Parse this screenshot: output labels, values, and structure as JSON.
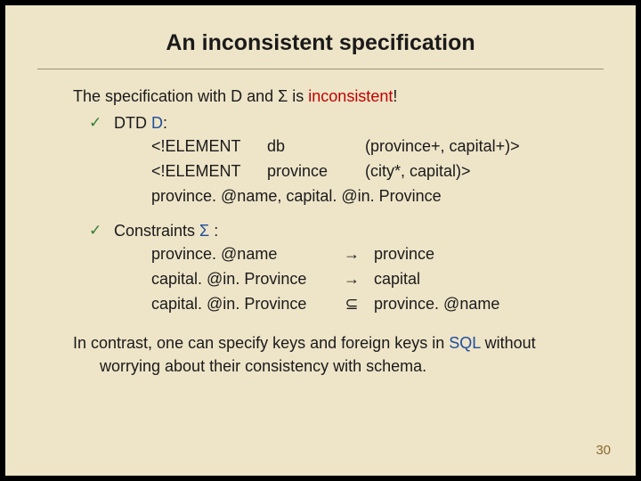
{
  "title": "An inconsistent specification",
  "intro": {
    "pre": "The specification with D and ",
    "sigma": "Σ",
    "mid": " is ",
    "word": "inconsistent",
    "post": "!"
  },
  "bullet1": {
    "head_pre": "DTD ",
    "head_d": "D",
    "head_post": ":",
    "row1": {
      "a": "<!ELEMENT",
      "b": "db",
      "c": "(province+,  capital+)>"
    },
    "row2": {
      "a": "<!ELEMENT",
      "b": "province",
      "c": "(city*,   capital)>"
    },
    "row3": "province. @name, capital. @in. Province"
  },
  "bullet2": {
    "head_pre": "Constraints ",
    "head_sigma": "Σ",
    "head_post": " :",
    "rows": [
      {
        "l": "province. @name",
        "op": "→",
        "r": "province"
      },
      {
        "l": "capital. @in. Province",
        "op": "→",
        "r": "capital"
      },
      {
        "l": "capital. @in. Province",
        "op": "⊆",
        "r": "province. @name"
      }
    ]
  },
  "closing": {
    "line1_pre": "In contrast, one can specify keys and foreign keys in ",
    "sql": "SQL",
    "line1_post": " without",
    "line2": "worrying about their consistency with schema."
  },
  "pagenum": "30"
}
